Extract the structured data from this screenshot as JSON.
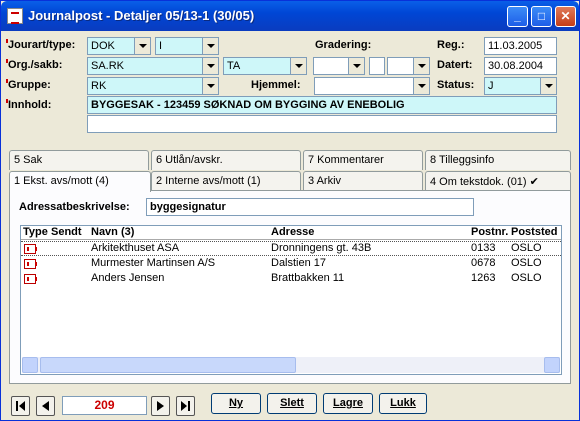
{
  "window": {
    "title": "Journalpost - Detaljer 05/13-1 (30/05)",
    "min_symbol": "_",
    "max_symbol": "□",
    "close_symbol": "✕"
  },
  "form": {
    "jourart_label": "Jourart/type:",
    "jourart_value": "DOK",
    "type_value": "I",
    "gradering_label": "Gradering:",
    "reg_label": "Reg.:",
    "reg_value": "11.03.2005",
    "org_label": "Org./sakb:",
    "org_value": "SA.RK",
    "sakb_value": "TA",
    "datert_label": "Datert:",
    "datert_value": "30.08.2004",
    "gruppe_label": "Gruppe:",
    "gruppe_value": "RK",
    "hjemmel_label": "Hjemmel:",
    "status_label": "Status:",
    "status_value": "J",
    "innhold_label": "Innhold:",
    "innhold_value": "BYGGESAK - 123459   SØKNAD OM BYGGING AV ENEBOLIG",
    "innhold_line2": ""
  },
  "tabs": {
    "row_top": [
      "5 Sak",
      "6 Utlån/avskr.",
      "7 Kommentarer",
      "8 Tilleggsinfo"
    ],
    "row_bottom": [
      "1 Ekst. avs/mott (4)",
      "2 Interne avs/mott (1)",
      "3 Arkiv",
      "4 Om tekstdok. (01)  ✔"
    ]
  },
  "panel": {
    "adresse_label": "Adressatbeskrivelse:",
    "adresse_value": "byggesignatur",
    "columns": [
      "Type",
      "Sendt",
      "Navn (3)",
      "Adresse",
      "Postnr.",
      "Poststed"
    ],
    "rows": [
      {
        "navn": "Arkitekthuset ASA",
        "adresse": "Dronningens gt. 43B",
        "postnr": "0133",
        "poststed": "OSLO"
      },
      {
        "navn": "Murmester Martinsen A/S",
        "adresse": "Dalstien 17",
        "postnr": "0678",
        "poststed": "OSLO"
      },
      {
        "navn": "Anders Jensen",
        "adresse": "Brattbakken 11",
        "postnr": "1263",
        "poststed": "OSLO"
      }
    ]
  },
  "footer": {
    "counter": "209",
    "ny": "Ny",
    "slett": "Slett",
    "lagre": "Lagre",
    "lukk": "Lukk"
  }
}
